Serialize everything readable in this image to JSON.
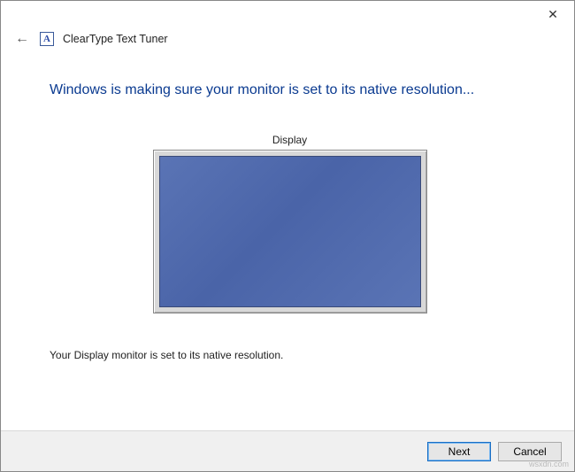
{
  "window": {
    "app_title": "ClearType Text Tuner",
    "app_icon_glyph": "A",
    "close_glyph": "✕",
    "back_glyph": "←"
  },
  "main": {
    "heading": "Windows is making sure your monitor is set to its native resolution...",
    "display_label": "Display",
    "status_text": "Your Display monitor is set to its native resolution."
  },
  "footer": {
    "next_label": "Next",
    "cancel_label": "Cancel"
  },
  "watermark": "wsxdn.com"
}
